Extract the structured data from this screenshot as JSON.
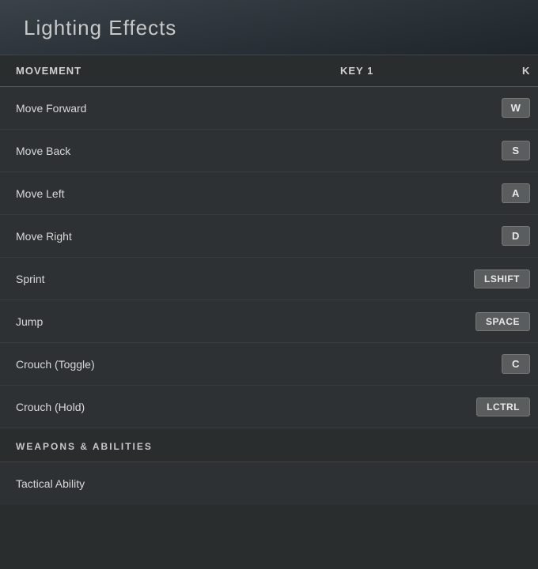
{
  "header": {
    "title": "Lighting Effects"
  },
  "table": {
    "col_action": "MOVEMENT",
    "col_key1": "KEY 1",
    "col_key2": "K"
  },
  "movement_section": {
    "label": "MOVEMENT",
    "rows": [
      {
        "action": "Move Forward",
        "key1": "W"
      },
      {
        "action": "Move Back",
        "key1": "S"
      },
      {
        "action": "Move Left",
        "key1": "A"
      },
      {
        "action": "Move Right",
        "key1": "D"
      },
      {
        "action": "Sprint",
        "key1": "LSHIFT"
      },
      {
        "action": "Jump",
        "key1": "SPACE"
      },
      {
        "action": "Crouch (Toggle)",
        "key1": "C"
      },
      {
        "action": "Crouch (Hold)",
        "key1": "LCTRL"
      }
    ]
  },
  "weapons_section": {
    "label": "WEAPONS & ABILITIES",
    "rows": [
      {
        "action": "Tactical Ability",
        "key1": ""
      }
    ]
  }
}
